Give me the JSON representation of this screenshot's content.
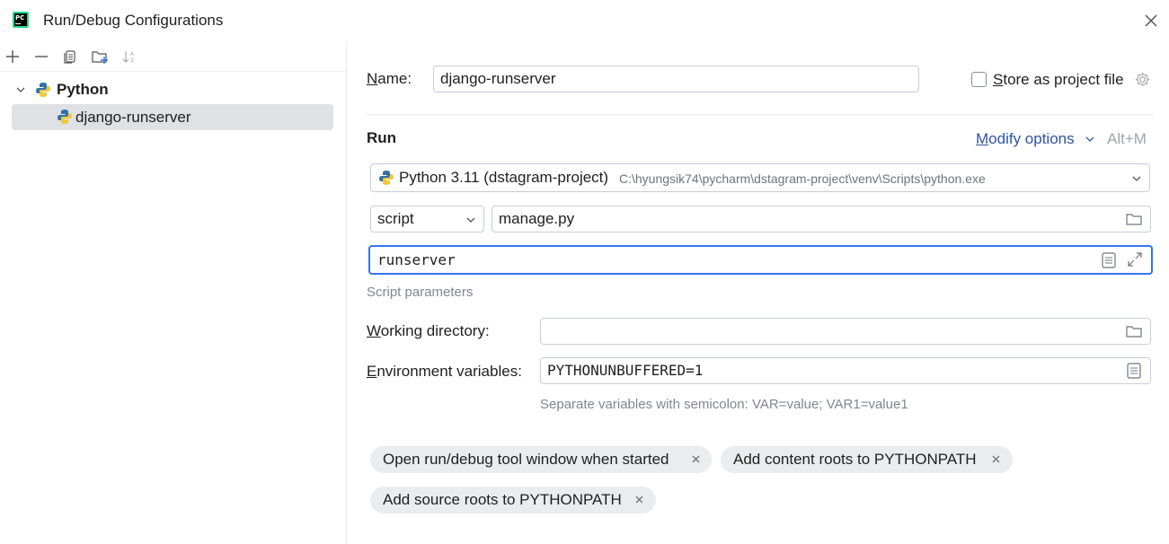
{
  "window": {
    "title": "Run/Debug Configurations",
    "logo_text": "PC"
  },
  "sidebar": {
    "toolbar": [
      "add-icon",
      "remove-icon",
      "copy-icon",
      "new-folder-icon",
      "sort-icon"
    ],
    "tree": {
      "group_label": "Python",
      "item_label": "django-runserver"
    }
  },
  "form": {
    "name_label_u": "N",
    "name_label_rest": "ame:",
    "name_value": "django-runserver",
    "store_label_u": "S",
    "store_label_rest": "tore as project file",
    "store_checked": false,
    "run_heading": "Run",
    "modify_options_u": "M",
    "modify_options_rest": "odify options",
    "modify_shortcut": "Alt+M",
    "interpreter_name": "Python 3.11 (dstagram-project)",
    "interpreter_path": "C:\\hyungsik74\\pycharm\\dstagram-project\\venv\\Scripts\\python.exe",
    "target_type": "script",
    "script_path": "manage.py",
    "script_params": "runserver",
    "script_params_hint": "Script parameters",
    "workdir_label_u": "W",
    "workdir_label_rest": "orking directory:",
    "workdir_value": "",
    "env_label_u": "E",
    "env_label_rest": "nvironment variables:",
    "env_value": "PYTHONUNBUFFERED=1",
    "env_hint": "Separate variables with semicolon: VAR=value; VAR1=value1"
  },
  "chips": [
    {
      "label": "Open run/debug tool window when started"
    },
    {
      "label": "Add content roots to PYTHONPATH"
    },
    {
      "label": "Add source roots to PYTHONPATH"
    }
  ],
  "colors": {
    "accent": "#3574f0",
    "link": "#2e55a3",
    "selection": "#dfe1e5",
    "chip_bg": "#ebecf0"
  }
}
